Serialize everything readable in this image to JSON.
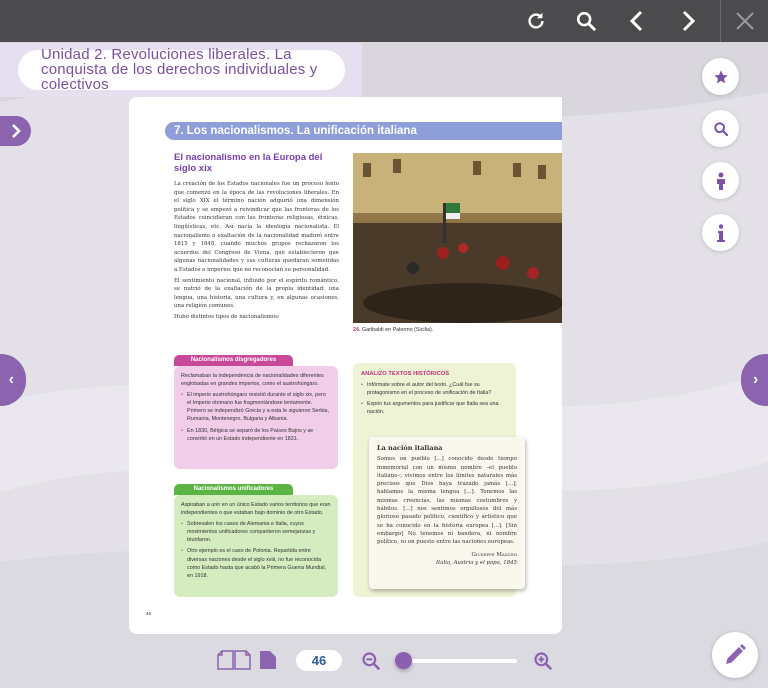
{
  "topbar": {
    "icons": [
      "refresh-icon",
      "search-icon",
      "chevron-left-icon",
      "chevron-right-icon",
      "close-icon"
    ]
  },
  "unit_title": "Unidad 2. Revoluciones liberales. La conquista de los derechos individuales y colectivos",
  "page": {
    "section_title": "7.  Los nacionalismos. La unificación italiana",
    "heading": "El nacionalismo en la Europa del siglo xix",
    "paragraphs": [
      "La creación de los Estados nacionales fue un proceso lento que comenzó en la época de las revoluciones liberales. En el siglo XIX el término nación adquirió una dimensión política y se empezó a reivindicar que las fronteras de los Estados coincidieran con las fronteras religiosas, étnicas, lingüísticas, etc. Así nacía la ideología nacionalista. El nacionalismo o exaltación de la nacionalidad maduró entre 1815 y 1848, cuando muchos grupos rechazaron los acuerdos del Congreso de Viena, que establecieron que algunas nacionalidades y sus culturas quedaran sometidas a Estados o imperios que no reconocían su personalidad.",
      "El sentimiento nacional, influido por el espíritu romántico, se nutrió de la exaltación de la propia identidad: una lengua, una historia, una cultura y, en algunas ocasiones, una religión comunes.",
      "Hubo distintos tipos de nacionalismos:"
    ],
    "disgregadores": {
      "title": "Nacionalismos disgregadores",
      "intro": "Reclamaban la independencia de nacionalidades diferentes englobadas en grandes imperios, como el austrohúngaro.",
      "items": [
        "El imperio austrohúngaro resistió durante el siglo xix, pero el Imperio otomano fue fragmentándose lentamente. Primero se independizó Grecia y a esta le siguieron Serbia, Rumania, Montenegro, Bulgaria y Albania.",
        "En 1830, Bélgica se separó de los Países Bajos y se convirtió en un Estado independiente en 1831."
      ]
    },
    "unificadores": {
      "title": "Nacionalismos unificadores",
      "intro": "Aspiraban a unir en un único Estado varios territorios que eran independientes o que estaban bajo dominio de otro Estado.",
      "items": [
        "Sobresalen los casos de Alemania e Italia, cuyos movimientos unificadores compartieron semejanzas y triunfaron.",
        "Otro ejemplo es el caso de Polonia. Repartida entre diversas naciones desde el siglo xviii, no fue reconocida como Estado hasta que acabó la Primera Guerra Mundial, en 1918."
      ]
    },
    "caption_num": "24.",
    "caption": "Garibaldi en Palermo (Sicilia).",
    "analiza": {
      "title": "ANALIZO TEXTOS HISTÓRICOS",
      "items": [
        "Infórmate sobre el autor del texto. ¿Cuál fue su protagonismo en el proceso de unificación de Italia?",
        "Expón tus argumentos para justificar que Italia sea una nación."
      ]
    },
    "quote": {
      "title": "La nación italiana",
      "text": "Somos un pueblo [...] conocido desde tiempo inmemorial con un mismo nombre –el pueblo italiano–; vivimos entre los límites naturales más precisos que Dios haya trazado jamás [...]; hablamos la misma lengua [...]. Tenemos las mismas creencias, las mismas costumbres y hábitos. [...] nos sentimos orgullosos del más glorioso pasado político, científico y artístico que se ha conocido en la historia europea [...]. [Sin embargo] No tenemos ni bandera, ni nombre político, ni un puesto entre las naciones europeas.",
      "author": "Giuseppe Mazzini",
      "source": "Italia, Austria y el papa, 1845"
    },
    "page_number_small": "46"
  },
  "side_buttons": [
    "star-icon",
    "search-icon",
    "person-icon",
    "info-icon"
  ],
  "bottom": {
    "current_page": "46",
    "zoom_level": 0.0
  },
  "colors": {
    "accent": "#8b63ae",
    "topbar": "#4b4b4d",
    "section": "#8e9ed8"
  }
}
